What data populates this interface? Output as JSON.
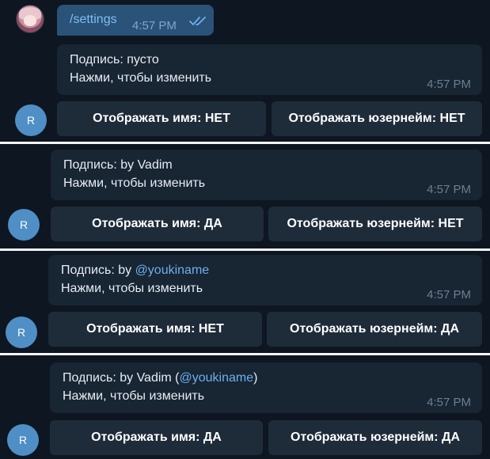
{
  "command_message": {
    "text": "/settings",
    "time": "4:57 PM"
  },
  "signature_label": "Подпись:",
  "tap_hint": "Нажми, чтобы изменить",
  "bot_avatar_letter": "R",
  "panels": [
    {
      "signature_value": "пусто",
      "time": "4:57 PM",
      "btn_name": "Отображать имя: НЕТ",
      "btn_username": "Отображать юзернейм: НЕТ"
    },
    {
      "signature_value": "by Vadim",
      "time": "4:57 PM",
      "btn_name": "Отображать имя: ДА",
      "btn_username": "Отображать юзернейм: НЕТ"
    },
    {
      "signature_prefix": "by ",
      "signature_handle": "@youkiname",
      "time": "4:57 PM",
      "btn_name": "Отображать имя: НЕТ",
      "btn_username": "Отображать юзернейм: ДА"
    },
    {
      "signature_prefix": "by Vadim (",
      "signature_handle": "@youkiname",
      "signature_suffix": ")",
      "time": "4:57 PM",
      "btn_name": "Отображать имя: ДА",
      "btn_username": "Отображать юзернейм: ДА"
    }
  ],
  "colors": {
    "background": "#0e1621",
    "outgoing_bubble": "#2b5278",
    "incoming_bubble": "#182533",
    "keyboard_button": "#1e2c3a",
    "link": "#6cb0ef",
    "bot_avatar": "#4f8fc6"
  }
}
